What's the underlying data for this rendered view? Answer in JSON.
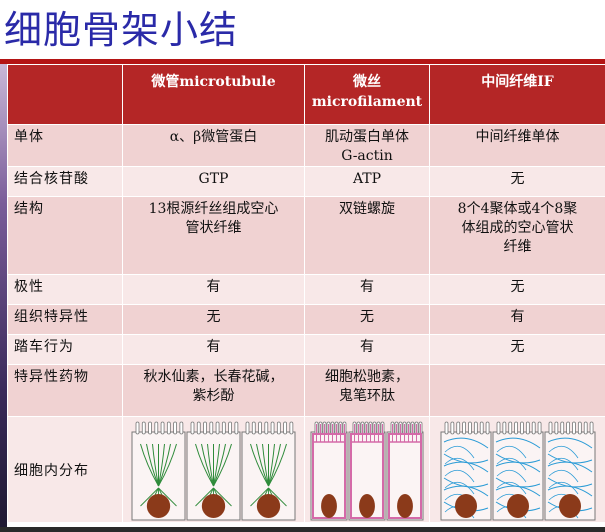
{
  "title": "细胞骨架小结",
  "table": {
    "headers": [
      "",
      "微管microtubule",
      "微丝\nmicrofilament",
      "中间纤维IF"
    ],
    "rows": [
      {
        "label": "单体",
        "cells": [
          "α、β微管蛋白",
          "肌动蛋白单体\nG-actin",
          "中间纤维单体"
        ]
      },
      {
        "label": "结合核苷酸",
        "cells": [
          "GTP",
          "ATP",
          "无"
        ]
      },
      {
        "label": "结构",
        "cells": [
          "13根源纤丝组成空心\n管状纤维",
          "双链螺旋",
          "8个4聚体或4个8聚\n体组成的空心管状\n纤维"
        ]
      },
      {
        "label": "极性",
        "cells": [
          "有",
          "有",
          "无"
        ]
      },
      {
        "label": "组织特异性",
        "cells": [
          "无",
          "无",
          "有"
        ]
      },
      {
        "label": "踏车行为",
        "cells": [
          "有",
          "有",
          "无"
        ]
      },
      {
        "label": "特异性药物",
        "cells": [
          "秋水仙素，长春花碱，\n紫杉酚",
          "细胞松驰素，\n鬼笔环肽",
          ""
        ]
      },
      {
        "label": "细胞内分布",
        "cells": [
          "",
          "",
          ""
        ]
      }
    ]
  },
  "colors": {
    "title": "#2a2aa8",
    "header": "#b42626",
    "row_odd": "#f0d2d2",
    "row_even": "#f8e8e8",
    "microtubule": "#2e8b3a",
    "microfilament": "#d46aa8",
    "intermediate_filament": "#2a9bd6",
    "nucleus": "#8b3a1a"
  },
  "distribution_images": [
    "microtubule-cells",
    "microfilament-cells",
    "intermediate-filament-cells"
  ]
}
